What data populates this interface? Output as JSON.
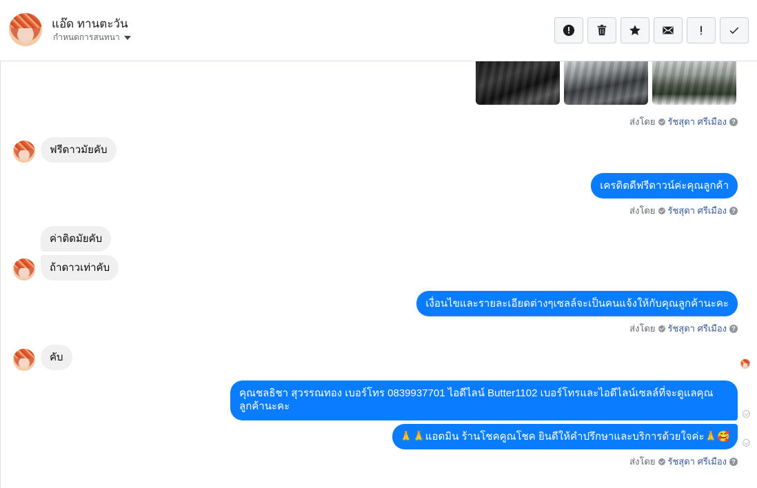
{
  "header": {
    "contact_name": "แอ๊ด ทานตะวัน",
    "subtitle": "กำหนดการสนทนา",
    "toolbar": {
      "spam_icon": "alert-circle-icon",
      "delete_icon": "trash-icon",
      "star_icon": "star-icon",
      "mail_icon": "envelope-icon",
      "important_icon": "exclamation-icon",
      "done_icon": "check-icon"
    }
  },
  "thread": {
    "sent_by_label": "ส่งโดย",
    "sent_by_name": "รัชสุดา ศรีเมือง",
    "help_glyph": "?",
    "messages": [
      {
        "from": "customer",
        "text": "ฟรีดาวมัยคับ"
      },
      {
        "from": "page",
        "text": "เครดิตดีฟรีดาวน์ค่ะคุณลูกค้า"
      },
      {
        "from": "customer",
        "text": "ค่าติดมัยคับ"
      },
      {
        "from": "customer",
        "text": "ถ้าดาวเท่าคับ"
      },
      {
        "from": "page",
        "text": "เงื่อนไขและรายละเอียดต่างๆเซลล์จะเป็นคนแจ้งให้กับคุณลูกค้านะคะ"
      },
      {
        "from": "customer",
        "text": "คับ"
      },
      {
        "from": "page",
        "text": "คุณชลธิชา สุวรรณทอง   เบอร์โทร 0839937701  ไอดีไลน์ Butter1102   เบอร์โทรและไอดีไลน์เซลล์ที่จะดูแลคุณลูกค้านะคะ"
      },
      {
        "from": "page",
        "text": "🙏🙏แอดมิน ร้านโชคคูณโชค ยินดีให้คำปรึกษาและบริการด้วยใจค่ะ🙏🥰"
      }
    ]
  },
  "colors": {
    "outgoing_bubble": "#0a7cff",
    "incoming_bubble": "#f1f0f0",
    "link_name": "#385898"
  }
}
